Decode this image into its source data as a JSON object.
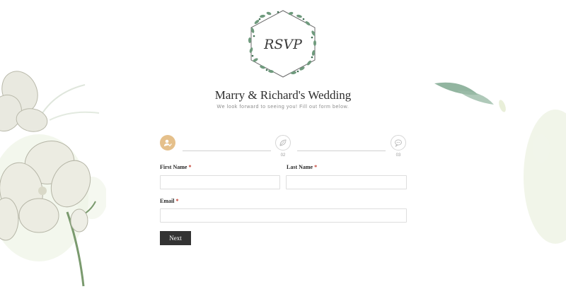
{
  "header": {
    "logo_text": "RSVP",
    "title": "Marry & Richard's Wedding",
    "subtitle": "We look forward to seeing you! Fill out form below."
  },
  "steps": [
    {
      "number": "",
      "icon": "user-check-icon",
      "state": "active",
      "color": "#e5c08b"
    },
    {
      "number": "02",
      "icon": "leaf-icon",
      "state": "inactive"
    },
    {
      "number": "03",
      "icon": "chat-bubble-icon",
      "state": "inactive"
    }
  ],
  "form": {
    "first_name": {
      "label": "First Name",
      "required_mark": "*",
      "value": ""
    },
    "last_name": {
      "label": "Last Name",
      "required_mark": "*",
      "value": ""
    },
    "email": {
      "label": "Email",
      "required_mark": "*",
      "value": ""
    },
    "next_label": "Next"
  },
  "colors": {
    "accent": "#e5c08b",
    "button": "#333333",
    "required": "#c0392b",
    "leaf_green": "#7fa88f"
  }
}
